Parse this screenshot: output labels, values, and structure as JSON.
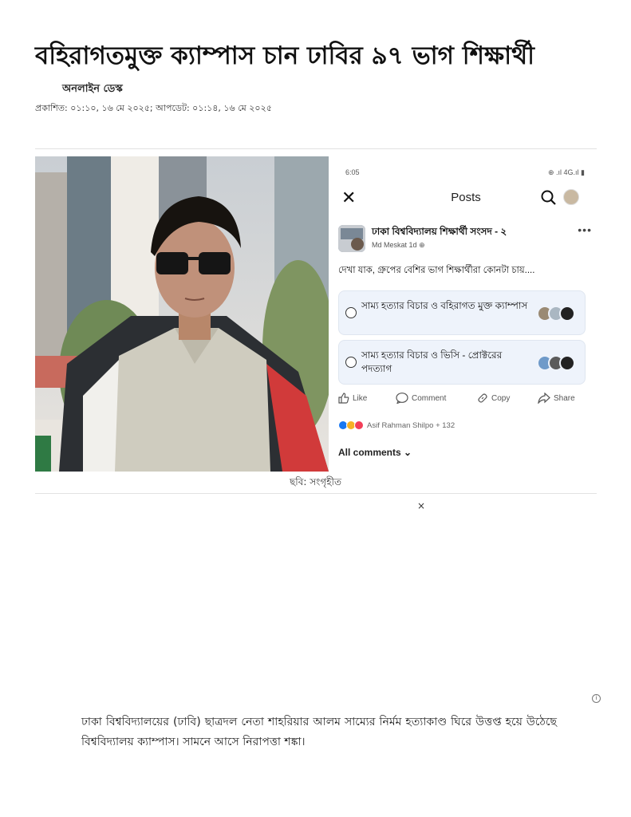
{
  "article": {
    "headline": "বহিরাগতমুক্ত ক্যাম্পাস চান ঢাবির ৯৭ ভাগ শিক্ষার্থী",
    "author": "অনলাইন ডেস্ক",
    "dateline": "প্রকাশিত: ০১:১০, ১৬ মে ২০২৫; আপডেট: ০১:১৪, ১৬ মে ২০২৫",
    "image_caption": "ছবি: সংগৃহীত",
    "paragraph": "ঢাকা বিশ্ববিদ্যালয়ের (ঢাবি) ছাত্রদল নেতা শাহরিয়ার আলম সাম্যের নির্মম হত্যাকাণ্ড ঘিরে উত্তপ্ত হয়ে উঠেছে বিশ্ববিদ্যালয় ক্যাম্পাস। সামনে আসে নিরাপত্তা শঙ্কা।"
  },
  "ad": {
    "close_label": "×",
    "choices_icon": "adchoices-icon"
  },
  "facebook_post": {
    "status_time": "6:05",
    "status_icons": "⊕ .ıl 4G.ıl ▮",
    "title": "Posts",
    "group_name": "ঢাকা বিশ্ববিদ্যালয় শিক্ষার্থী সংসদ - ২",
    "author": "Md Meskat",
    "time": "1d",
    "more_label": "•••",
    "body": "দেখা যাক, গ্রুপের বেশির ভাগ শিক্ষার্থীরা কোনটা চায়....",
    "poll_options": [
      {
        "label": "সাম্য হত্যার বিচার ও বহিরাগত মুক্ত ক্যাম্পাস"
      },
      {
        "label": "সাম্য হত্যার বিচার ও ভিসি - প্রোক্টরের পদত্যাগ"
      }
    ],
    "actions": {
      "like": "Like",
      "comment": "Comment",
      "copy": "Copy",
      "share": "Share"
    },
    "reactions_text": "Asif Rahman Shilpo + 132",
    "all_comments": "All comments ⌄"
  },
  "colors": {
    "poll_bg": "#eef3fb",
    "like_blue": "#1877f2",
    "love_red": "#f33e58",
    "haha_yellow": "#f7b125"
  }
}
